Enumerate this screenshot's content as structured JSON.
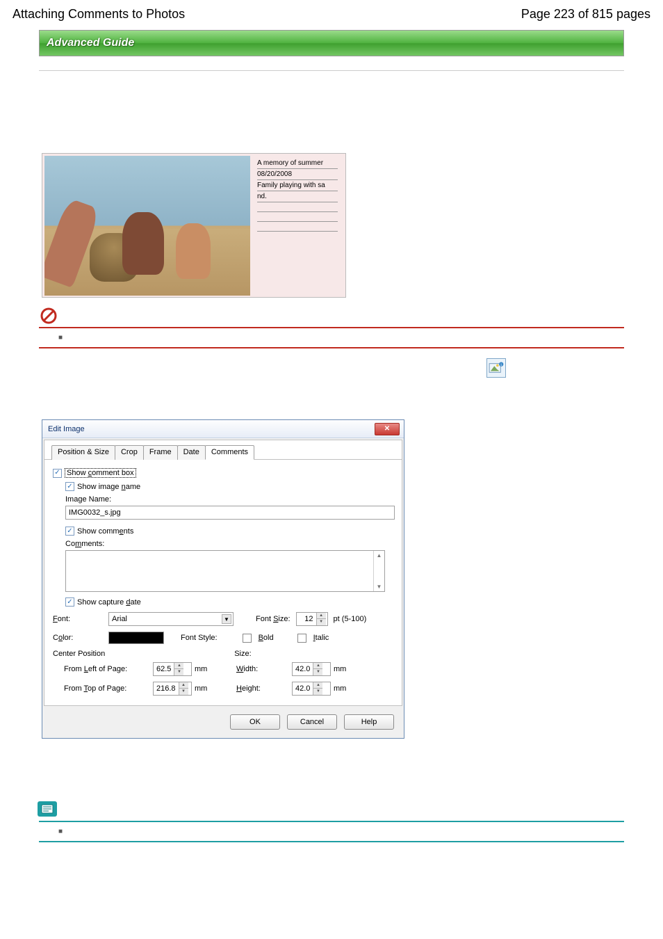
{
  "page": {
    "title": "Attaching Comments to Photos",
    "page_indicator": "Page 223 of 815 pages",
    "banner": "Advanced Guide"
  },
  "preview": {
    "line1": "A memory of summer",
    "line2": "08/20/2008",
    "line3": "Family playing with sa",
    "line4": "nd."
  },
  "important": {
    "bullet": "■"
  },
  "dialog": {
    "title": "Edit Image",
    "tabs": {
      "position": "Position & Size",
      "crop": "Crop",
      "frame": "Frame",
      "date": "Date",
      "comments": "Comments"
    },
    "show_comment_box": "Show comment box",
    "show_image_name": "Show image name",
    "image_name_label": "Image Name:",
    "image_name_value": "IMG0032_s.jpg",
    "show_comments": "Show comments",
    "comments_label": "Comments:",
    "show_capture_date": "Show capture date",
    "font_label": "Font:",
    "font_value": "Arial",
    "font_size_label": "Font Size:",
    "font_size_value": "12",
    "font_size_range": "pt (5-100)",
    "color_label": "Color:",
    "font_style_label": "Font Style:",
    "bold_label": "Bold",
    "italic_label": "Italic",
    "center_position": "Center Position",
    "size_label": "Size:",
    "from_left": "From Left of Page:",
    "from_left_value": "62.5",
    "width_label": "Width:",
    "width_value": "42.0",
    "from_top": "From Top of Page:",
    "from_top_value": "216.8",
    "height_label": "Height:",
    "height_value": "42.0",
    "mm": "mm",
    "ok": "OK",
    "cancel": "Cancel",
    "help": "Help"
  },
  "note": {
    "bullet": "■"
  }
}
